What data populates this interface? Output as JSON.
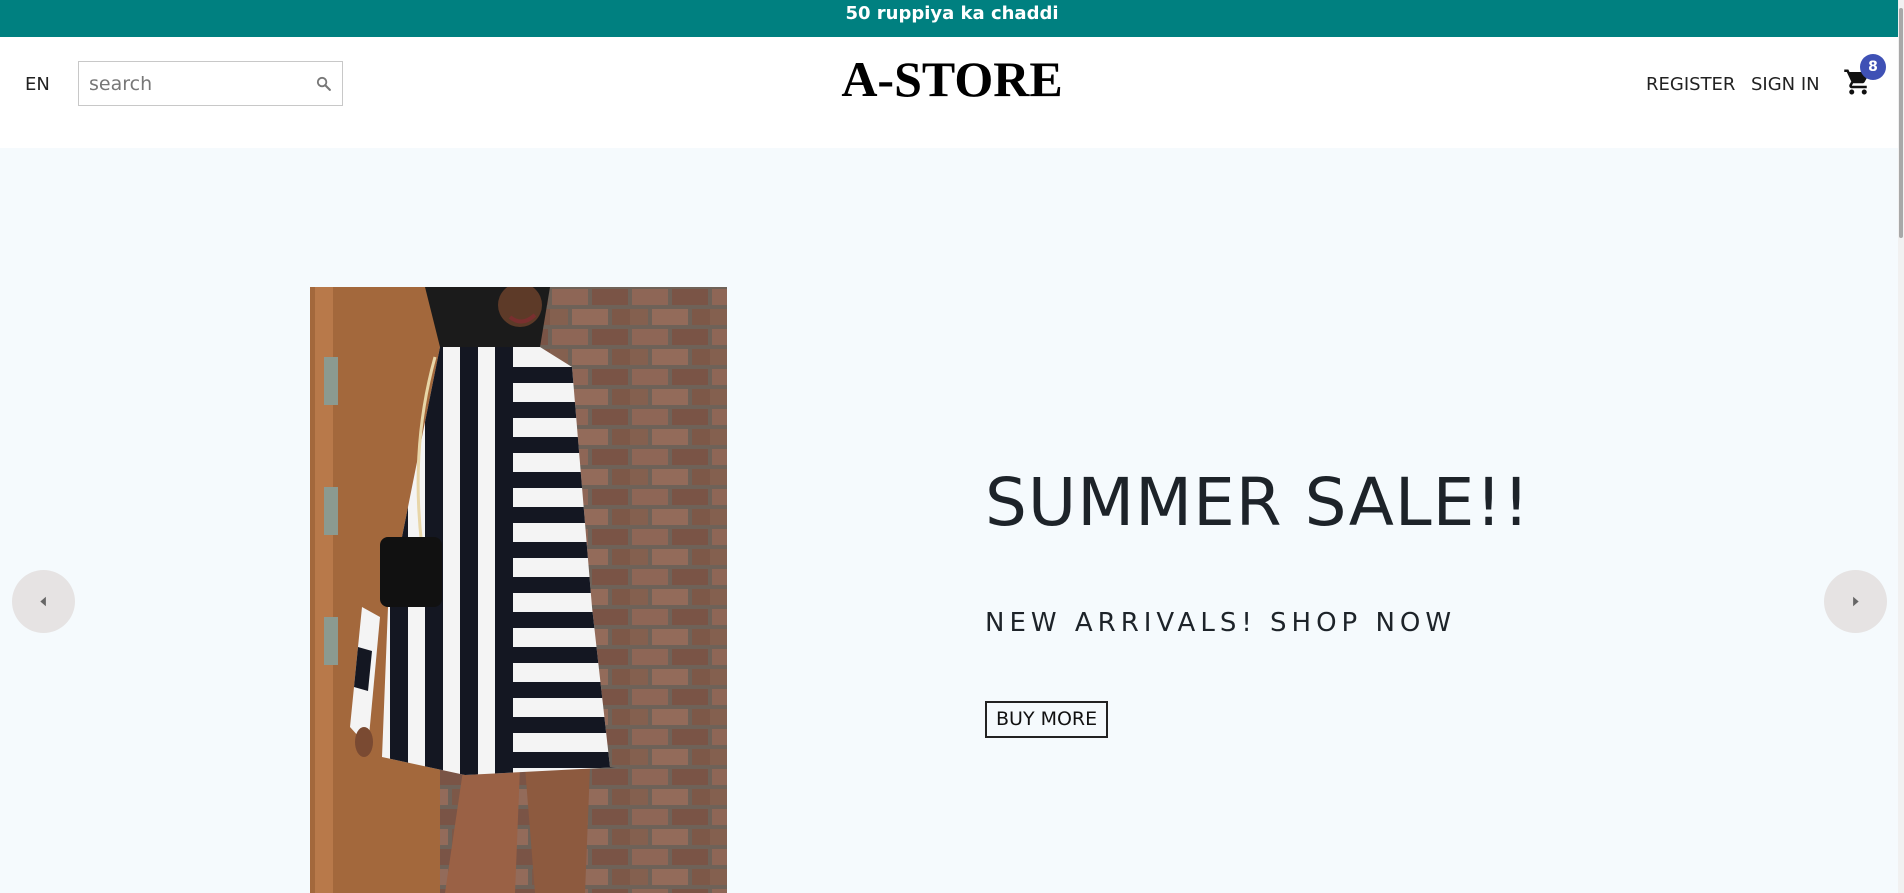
{
  "announcement": {
    "text": "50 ruppiya ka chaddi"
  },
  "header": {
    "language": "EN",
    "search": {
      "placeholder": "search",
      "value": ""
    },
    "logo": "A-STORE",
    "register_label": "REGISTER",
    "signin_label": "SIGN IN",
    "cart_count": "8"
  },
  "hero": {
    "title": "SUMMER SALE!!",
    "subtitle": "NEW ARRIVALS! SHOP NOW",
    "button_label": "BUY MORE"
  },
  "colors": {
    "announcement_bg": "#008080",
    "hero_bg": "#f5fafd",
    "badge_bg": "#3f51b5",
    "arrow_bg": "#e6e3e3"
  },
  "icons": {
    "search": "search-icon",
    "cart": "cart-icon",
    "prev": "arrow-left-icon",
    "next": "arrow-right-icon"
  }
}
